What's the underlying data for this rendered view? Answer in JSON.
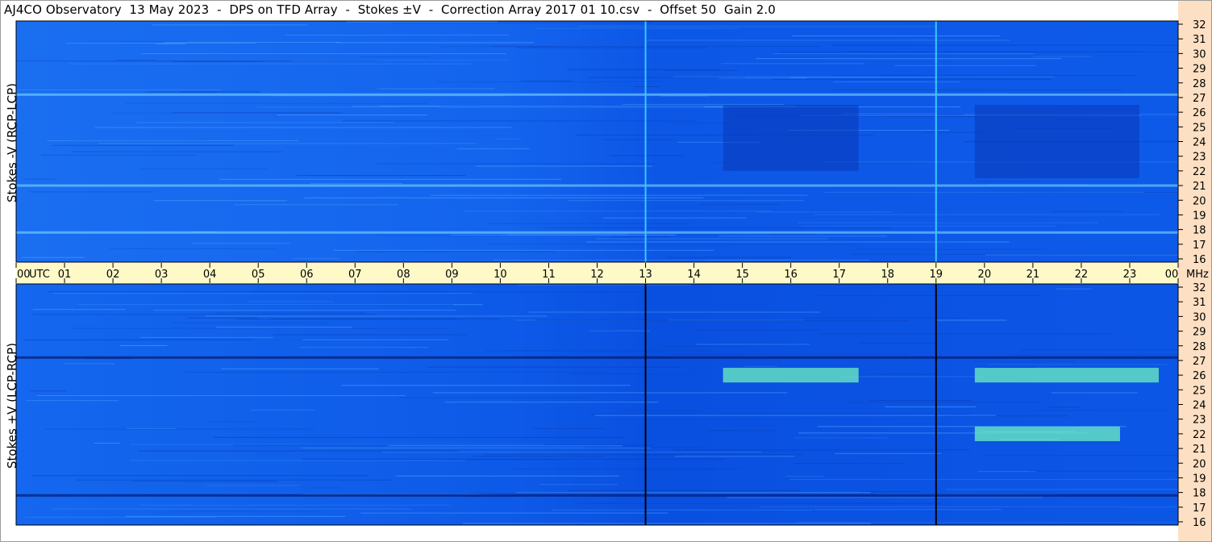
{
  "header": {
    "title": "AJ4CO Observatory  13 May 2023  -  DPS on TFD Array  -  Stokes ±V  -  Correction Array 2017 01 10.csv  -  Offset 50  Gain 2.0"
  },
  "chart_data": [
    {
      "type": "heatmap",
      "panel": "top",
      "ylabel": "Stokes -V (RCP-LCP)",
      "x_unit": "UTC",
      "y_unit": "MHz",
      "xlim": [
        0,
        24
      ],
      "ylim": [
        16,
        32
      ],
      "yticks": [
        "16",
        "17",
        "18",
        "19",
        "20",
        "21",
        "22",
        "23",
        "24",
        "25",
        "26",
        "27",
        "28",
        "29",
        "30",
        "31",
        "32"
      ],
      "vertical_marks_utc": [
        13,
        19
      ],
      "bright_bands_mhz": [
        17.8,
        21.0,
        27.2
      ],
      "dark_blocks": [
        {
          "utc": [
            14.6,
            17.4
          ],
          "mhz": [
            22,
            26.5
          ]
        },
        {
          "utc": [
            19.8,
            23.2
          ],
          "mhz": [
            21.5,
            26.5
          ]
        }
      ]
    },
    {
      "type": "heatmap",
      "panel": "bottom",
      "ylabel": "Stokes +V (LCP-RCP)",
      "x_unit": "UTC",
      "y_unit": "MHz",
      "xlim": [
        0,
        24
      ],
      "ylim": [
        16,
        32
      ],
      "yticks": [
        "16",
        "17",
        "18",
        "19",
        "20",
        "21",
        "22",
        "23",
        "24",
        "25",
        "26",
        "27",
        "28",
        "29",
        "30",
        "31",
        "32"
      ],
      "vertical_marks_utc": [
        13,
        19
      ],
      "dark_bands_mhz": [
        17.8,
        27.2
      ],
      "bright_blocks": [
        {
          "utc": [
            14.6,
            17.4
          ],
          "mhz": [
            25.5,
            26.5
          ]
        },
        {
          "utc": [
            19.8,
            23.6
          ],
          "mhz": [
            25.5,
            26.5
          ]
        },
        {
          "utc": [
            19.8,
            22.8
          ],
          "mhz": [
            21.5,
            22.5
          ]
        }
      ]
    }
  ],
  "time_axis": {
    "labels": [
      "00",
      "01",
      "02",
      "03",
      "04",
      "05",
      "06",
      "07",
      "08",
      "09",
      "10",
      "11",
      "12",
      "13",
      "14",
      "15",
      "16",
      "17",
      "18",
      "19",
      "20",
      "21",
      "22",
      "23",
      "00"
    ],
    "utc_label": "UTC",
    "mhz_label": "MHz"
  },
  "colors": {
    "background": "#0a58f0",
    "strip": "#fff9c8",
    "right_axis": "#fde0c4",
    "frame": "#000000"
  }
}
